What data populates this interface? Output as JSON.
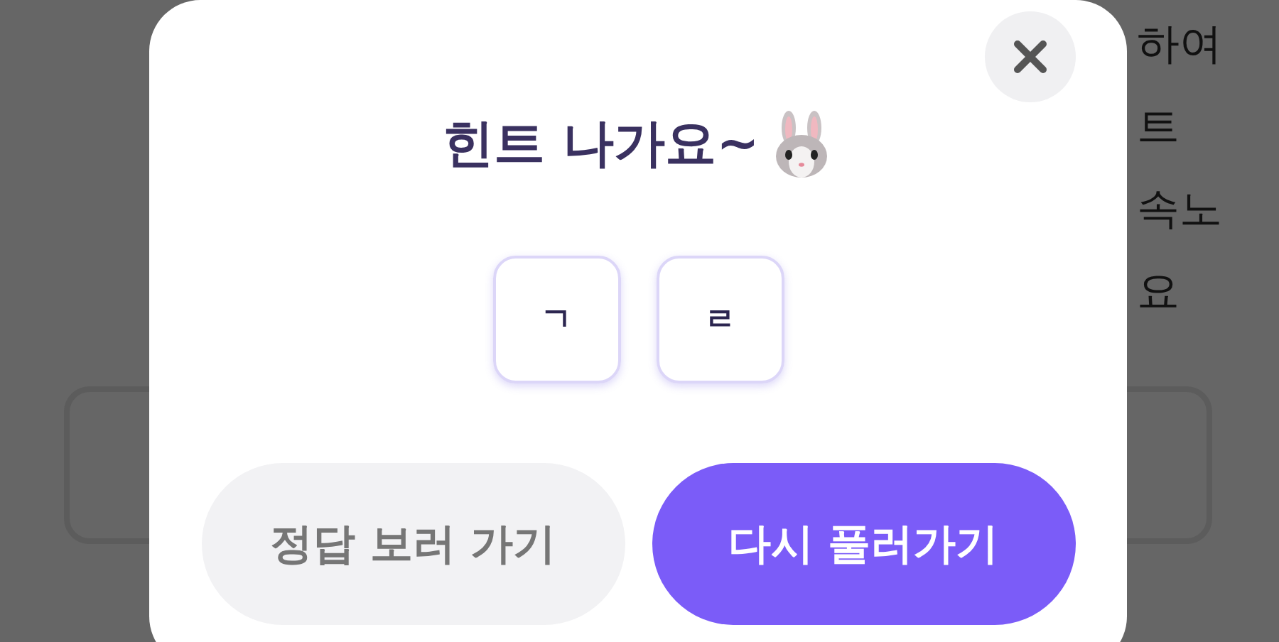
{
  "background_text": [
    "하여",
    "트",
    "속노",
    "요"
  ],
  "modal": {
    "title": "힌트 나가요~",
    "hint_letters": [
      "ㄱ",
      "ㄹ"
    ],
    "buttons": [
      {
        "label": "정답 보러 가기",
        "kind": "secondary"
      },
      {
        "label": "다시 풀러가기",
        "kind": "primary"
      }
    ]
  }
}
